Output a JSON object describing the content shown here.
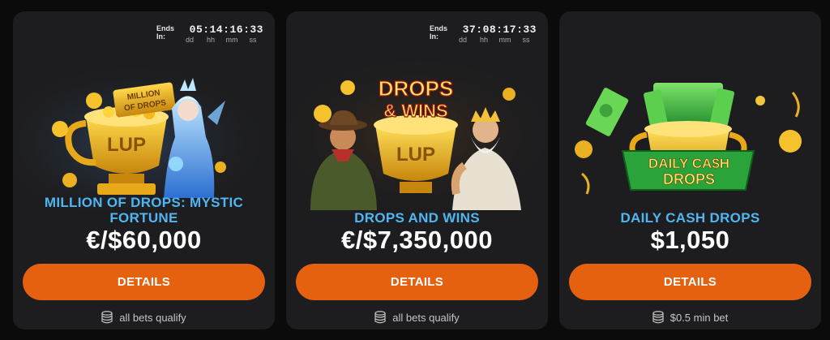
{
  "promos": [
    {
      "name": "MILLION OF DROPS: MYSTIC FORTUNE",
      "amount": "€/$60,000",
      "ends_label_1": "Ends",
      "ends_label_2": "In:",
      "countdown": "05:14:16:33",
      "units": [
        "dd",
        "hh",
        "mm",
        "ss"
      ],
      "cta": "DETAILS",
      "footnote": "all bets qualify",
      "logo_text_1": "MILLION",
      "logo_text_2": "OF DROPS",
      "trophy_text": "LUP"
    },
    {
      "name": "DROPS AND WINS",
      "amount": "€/$7,350,000",
      "ends_label_1": "Ends",
      "ends_label_2": "In:",
      "countdown": "37:08:17:33",
      "units": [
        "dd",
        "hh",
        "mm",
        "ss"
      ],
      "cta": "DETAILS",
      "footnote": "all bets qualify",
      "logo_text_1": "DROPS",
      "logo_text_2": "& WINS",
      "trophy_text": "LUP"
    },
    {
      "name": "DAILY CASH DROPS",
      "amount": "$1,050",
      "cta": "DETAILS",
      "footnote": "$0.5 min bet",
      "logo_text_1": "DAILY CA$H",
      "logo_text_2": "DROPS"
    }
  ],
  "colors": {
    "accent": "#e5600f",
    "title_blue": "#4fb6f2",
    "card_bg": "#1d1d1f",
    "page_bg": "#0b0b0c",
    "gold": "#f2b615",
    "cash_green": "#3bb94a"
  },
  "icons": {
    "footnote": "coin-stack-icon"
  }
}
